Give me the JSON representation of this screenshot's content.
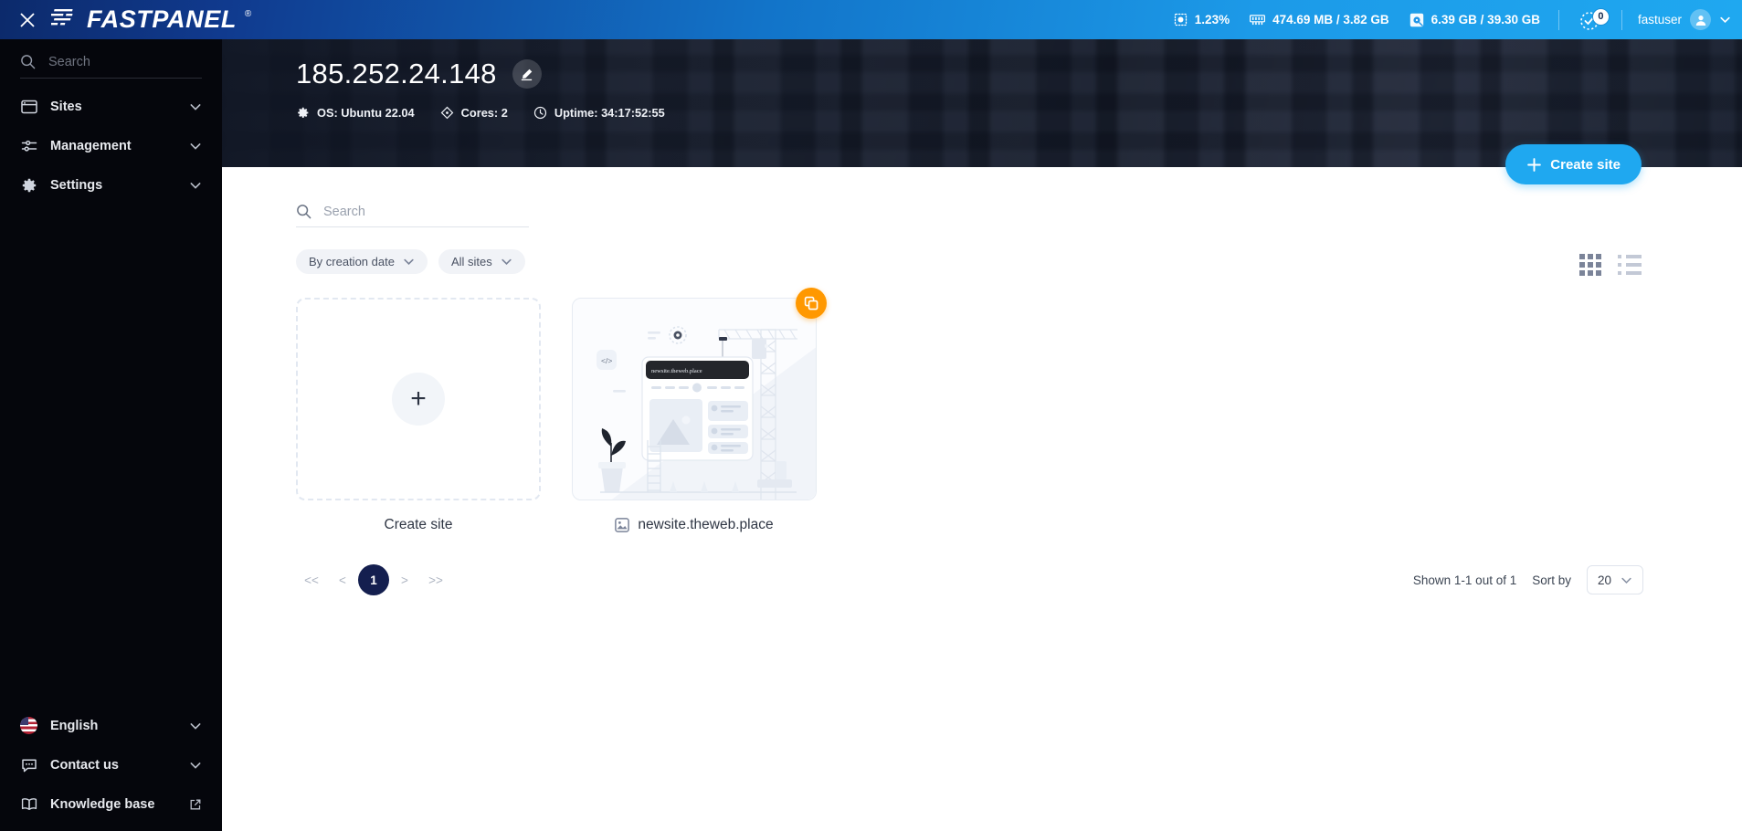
{
  "topbar": {
    "close_label": "close-window",
    "brand": "FASTPANEL",
    "brand_reg": "®",
    "stats": [
      {
        "icon": "cpu-icon",
        "value": "1.23%"
      },
      {
        "icon": "ram-icon",
        "value": "474.69 MB / 3.82 GB"
      },
      {
        "icon": "disk-icon",
        "value": "6.39 GB / 39.30 GB"
      }
    ],
    "tasks": {
      "icon": "task-check-icon",
      "badge": "0"
    },
    "user": {
      "name": "fastuser",
      "icon": "user-icon",
      "chevron": "chevron-down-icon"
    }
  },
  "sidebar": {
    "search_placeholder": "Search",
    "search_value": "",
    "items": [
      {
        "label": "Sites",
        "icon": "window-icon",
        "chevron": "chevron-down-icon"
      },
      {
        "label": "Management",
        "icon": "sliders-icon",
        "chevron": "chevron-down-icon"
      },
      {
        "label": "Settings",
        "icon": "gear-icon",
        "chevron": "chevron-down-icon"
      }
    ],
    "bottom_items": [
      {
        "label": "English",
        "icon": "us-flag-icon",
        "trailing": "chevron-down-icon"
      },
      {
        "label": "Contact us",
        "icon": "chat-bubble-icon",
        "trailing": "chevron-down-icon"
      },
      {
        "label": "Knowledge base",
        "icon": "book-icon",
        "trailing": "external-link-icon"
      }
    ]
  },
  "banner": {
    "server_ip": "185.252.24.148",
    "edit_icon": "pencil-icon",
    "meta": [
      {
        "icon": "gear-icon",
        "label": "OS: Ubuntu 22.04"
      },
      {
        "icon": "cores-icon",
        "label": "Cores: 2"
      },
      {
        "icon": "clock-icon",
        "label": "Uptime: 34:17:52:55"
      }
    ]
  },
  "actions": {
    "create_site_button": "Create site",
    "plus_icon": "plus-icon"
  },
  "main": {
    "search_placeholder": "Search",
    "search_value": "",
    "filters": [
      {
        "label": "By creation date",
        "icon": "chevron-down-icon"
      },
      {
        "label": "All sites",
        "icon": "chevron-down-icon"
      }
    ],
    "view_modes": [
      {
        "name": "grid-view",
        "active": true
      },
      {
        "name": "list-view",
        "active": false
      }
    ],
    "cards": [
      {
        "type": "create",
        "label": "Create site",
        "icon": "plus-icon"
      },
      {
        "type": "site",
        "label": "newsite.theweb.place",
        "icon": "image-icon",
        "badge_icon": "copy-icon",
        "thumbnail_address": "newsite.theweb.place"
      }
    ]
  },
  "pagination": {
    "first": "<<",
    "prev": "<",
    "pages": [
      "1"
    ],
    "active_page": "1",
    "next": ">",
    "last": ">>",
    "shown_text": "Shown 1-1 out of 1",
    "sort_by_label": "Sort by",
    "per_page_value": "20",
    "per_page_chevron": "chevron-down-icon"
  },
  "colors": {
    "accent_blue": "#1fa8f0",
    "brand_navy": "#0c2a6b",
    "badge_orange": "#ff9800",
    "active_page": "#141f4f",
    "sidebar_bg": "#05060c"
  }
}
